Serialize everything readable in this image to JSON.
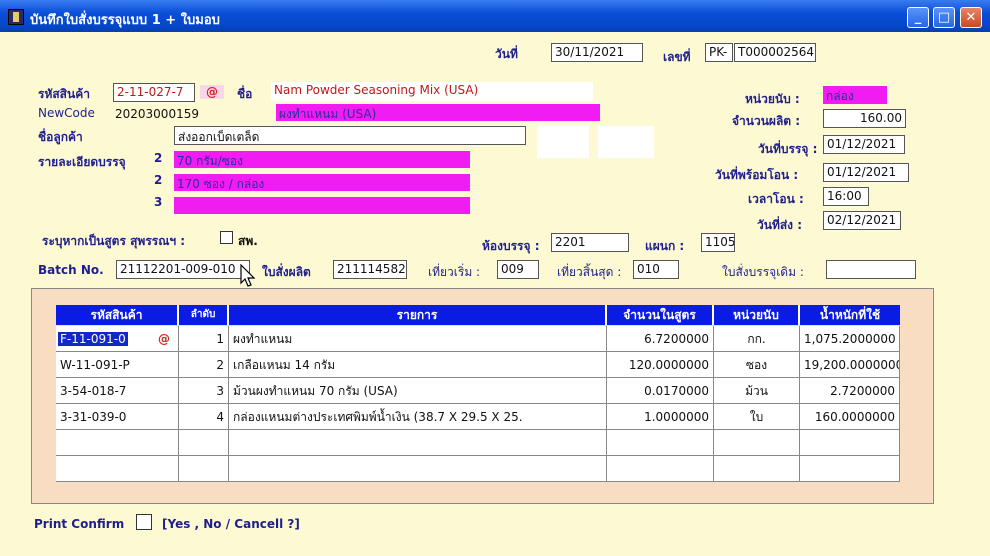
{
  "window": {
    "title": "บันทึกใบสั่งบรรจุแบบ 1 + ใบมอบ",
    "controls": {
      "minimize": "_",
      "maximize": "□",
      "close": "✕"
    }
  },
  "header": {
    "date_label": "วันที่",
    "date_value": "30/11/2021",
    "number_label": "เลขที่",
    "number_prefix": "PK-",
    "number_value": "T000002564"
  },
  "product": {
    "code_label": "รหัสสินค้า",
    "code_value": "2-11-027-7",
    "at_symbol": "@",
    "name_label": "ชื่อ",
    "name_en": "Nam Powder Seasoning Mix (USA)",
    "name_th": "ผงทำแหนม (USA)",
    "newcode_label": "NewCode",
    "newcode_value": "20203000159",
    "customer_label": "ชื่อลูกค้า",
    "customer_value": "ส่งออกเบ็ดเตล็ด",
    "packing_detail_label": "รายละเอียดบรรจุ",
    "packing_lines": [
      {
        "num": "2",
        "text": "70 กรัม/ซอง"
      },
      {
        "num": "2",
        "text": "170 ซอง / กล่อง"
      },
      {
        "num": "3",
        "text": ""
      }
    ],
    "special_formula_label": "ระบุหากเป็นสูตร สุพรรณฯ :",
    "special_formula_checkbox_label": "สพ."
  },
  "right_panel": {
    "unit_label": "หน่วยนับ :",
    "unit_value": "กล่อง",
    "qty_label": "จำนวนผลิต :",
    "qty_value": "160.00",
    "pack_date_label": "วันที่บรรจุ :",
    "pack_date_value": "01/12/2021",
    "ready_date_label": "วันที่พร้อมโอน :",
    "ready_date_value": "01/12/2021",
    "transfer_time_label": "เวลาโอน :",
    "transfer_time_value": "16:00",
    "ship_date_label": "วันที่ส่ง :",
    "ship_date_value": "02/12/2021"
  },
  "room": {
    "room_label": "ห้องบรรจุ :",
    "room_value": "2201",
    "dept_label": "แผนก :",
    "dept_value": "1105"
  },
  "batch": {
    "batch_label": "Batch No.",
    "batch_value": "21112201-009-010",
    "order_label": "ใบสั่งผลิต",
    "order_value": "211114582",
    "round_start_label": "เที่ยวเริ่ม :",
    "round_start_value": "009",
    "round_end_label": "เที่ยวสิ้นสุด :",
    "round_end_value": "010",
    "old_order_label": "ใบสั่งบรรจุเดิม :",
    "old_order_value": ""
  },
  "table": {
    "columns": [
      "รหัสสินค้า",
      "ลำดับ",
      "รายการ",
      "จำนวนในสูตร",
      "หน่วยนับ",
      "น้ำหนักที่ใช้"
    ],
    "rows": [
      {
        "code": "F-11-091-0",
        "seq": "1",
        "item": "ผงทำแหนม",
        "qty": "6.7200000",
        "unit": "กก.",
        "weight": "1,075.2000000"
      },
      {
        "code": "W-11-091-P",
        "seq": "2",
        "item": "เกลือแหนม 14 กรัม",
        "qty": "120.0000000",
        "unit": "ซอง",
        "weight": "19,200.0000000"
      },
      {
        "code": "3-54-018-7",
        "seq": "3",
        "item": "ม้วนผงทำแหนม 70 กรัม (USA)",
        "qty": "0.0170000",
        "unit": "ม้วน",
        "weight": "2.7200000"
      },
      {
        "code": "3-31-039-0",
        "seq": "4",
        "item": "กล่องแหนมต่างประเทศพิมพ์น้ำเงิน (38.7 X 29.5 X 25.",
        "qty": "1.0000000",
        "unit": "ใบ",
        "weight": "160.0000000"
      },
      {
        "code": "",
        "seq": "",
        "item": "",
        "qty": "",
        "unit": "",
        "weight": ""
      },
      {
        "code": "",
        "seq": "",
        "item": "",
        "qty": "",
        "unit": "",
        "weight": ""
      }
    ]
  },
  "footer": {
    "print_confirm_label": "Print Confirm",
    "print_confirm_hint": "[Yes , No / Cancell ?]"
  },
  "colors": {
    "title_bar": "#0a4fd8",
    "form_bg": "#fdf9d3",
    "highlight_pink": "#f01cf2",
    "grid_header": "#0a1be6",
    "label_text": "#1f1f8c",
    "grid_panel": "#f8ddc3"
  }
}
